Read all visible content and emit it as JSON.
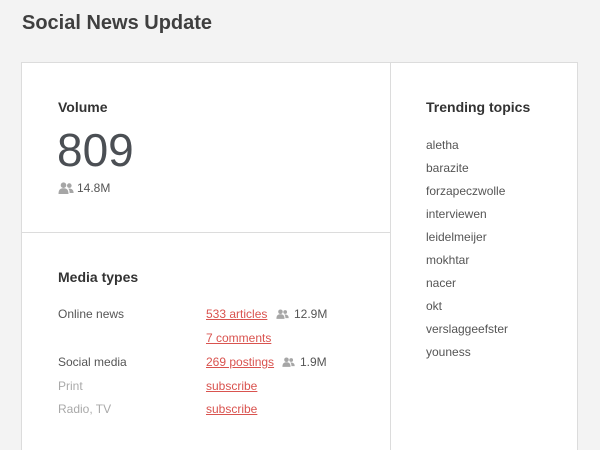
{
  "page_title": "Social News Update",
  "volume": {
    "heading": "Volume",
    "value": "809",
    "reach": "14.8M"
  },
  "media_types": {
    "heading": "Media types",
    "online_news": {
      "label": "Online news",
      "articles_link": "533 articles",
      "reach": "12.9M",
      "comments_link": "7 comments"
    },
    "social_media": {
      "label": "Social media",
      "postings_link": "269 postings",
      "reach": "1.9M"
    },
    "print": {
      "label": "Print",
      "subscribe_link": "subscribe"
    },
    "radio_tv": {
      "label": "Radio, TV",
      "subscribe_link": "subscribe"
    }
  },
  "trending": {
    "heading": "Trending topics",
    "topics": [
      "aletha",
      "barazite",
      "forzapeczwolle",
      "interviewen",
      "leidelmeijer",
      "mokhtar",
      "nacer",
      "okt",
      "verslaggeefster",
      "youness"
    ]
  },
  "colors": {
    "link": "#d9534f",
    "muted_text": "#a9a9a9",
    "icon": "#a6a6a6",
    "border": "#dcdcdc",
    "background": "#f3f3f3"
  },
  "icons": {
    "reach": "people-icon"
  }
}
